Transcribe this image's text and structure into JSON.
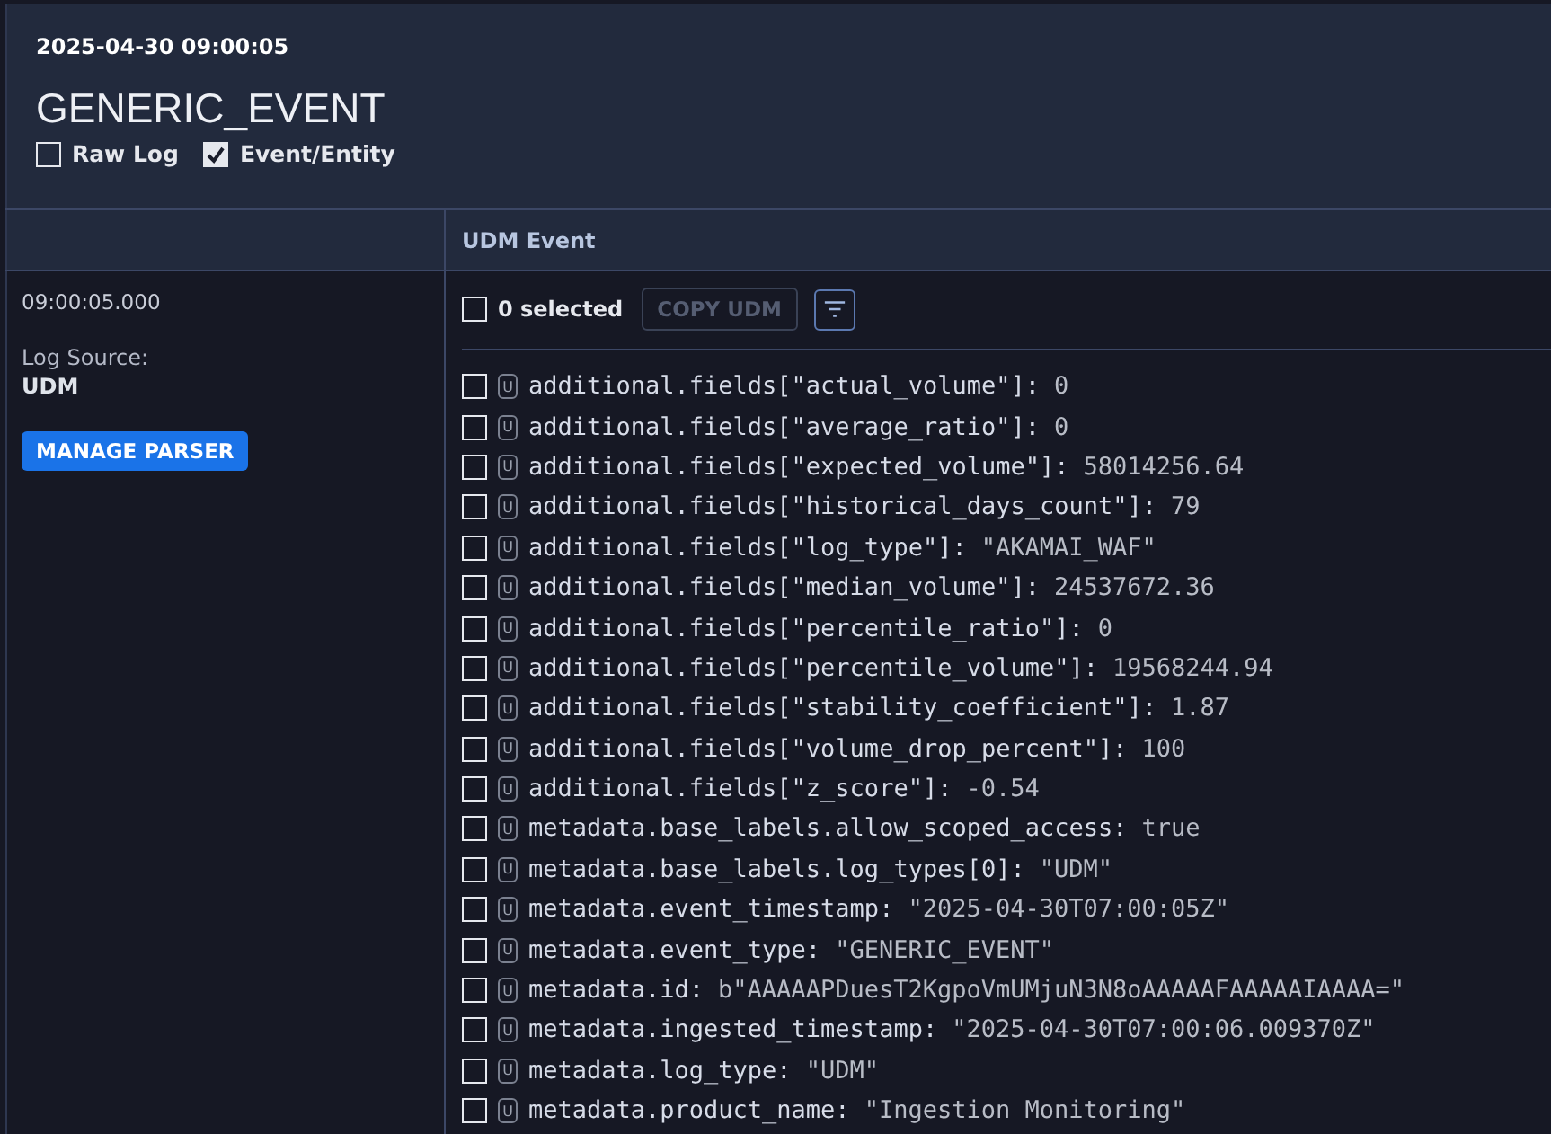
{
  "header": {
    "timestamp": "2025-04-30 09:00:05",
    "title": "GENERIC_EVENT",
    "toggles": [
      {
        "label": "Raw Log",
        "checked": false
      },
      {
        "label": "Event/Entity",
        "checked": true
      }
    ]
  },
  "table": {
    "column_2": "UDM Event"
  },
  "left": {
    "time": "09:00:05.000",
    "source_label": "Log Source:",
    "source_value": "UDM",
    "button": "MANAGE PARSER"
  },
  "toolbar": {
    "selected_count": "0 selected",
    "select_all": false,
    "copy_button": "COPY UDM"
  },
  "fields": [
    {
      "checked": false,
      "badge": "U",
      "key": "additional.fields[\"actual_volume\"]:",
      "value": "0"
    },
    {
      "checked": false,
      "badge": "U",
      "key": "additional.fields[\"average_ratio\"]:",
      "value": "0"
    },
    {
      "checked": false,
      "badge": "U",
      "key": "additional.fields[\"expected_volume\"]:",
      "value": "58014256.64"
    },
    {
      "checked": false,
      "badge": "U",
      "key": "additional.fields[\"historical_days_count\"]:",
      "value": "79"
    },
    {
      "checked": false,
      "badge": "U",
      "key": "additional.fields[\"log_type\"]:",
      "value": "\"AKAMAI_WAF\""
    },
    {
      "checked": false,
      "badge": "U",
      "key": "additional.fields[\"median_volume\"]:",
      "value": "24537672.36"
    },
    {
      "checked": false,
      "badge": "U",
      "key": "additional.fields[\"percentile_ratio\"]:",
      "value": "0"
    },
    {
      "checked": false,
      "badge": "U",
      "key": "additional.fields[\"percentile_volume\"]:",
      "value": "19568244.94"
    },
    {
      "checked": false,
      "badge": "U",
      "key": "additional.fields[\"stability_coefficient\"]:",
      "value": "1.87"
    },
    {
      "checked": false,
      "badge": "U",
      "key": "additional.fields[\"volume_drop_percent\"]:",
      "value": "100"
    },
    {
      "checked": false,
      "badge": "U",
      "key": "additional.fields[\"z_score\"]:",
      "value": "-0.54"
    },
    {
      "checked": false,
      "badge": "U",
      "key": "metadata.base_labels.allow_scoped_access:",
      "value": "true"
    },
    {
      "checked": false,
      "badge": "U",
      "key": "metadata.base_labels.log_types[0]:",
      "value": "\"UDM\""
    },
    {
      "checked": false,
      "badge": "U",
      "key": "metadata.event_timestamp:",
      "value": "\"2025-04-30T07:00:05Z\""
    },
    {
      "checked": false,
      "badge": "U",
      "key": "metadata.event_type:",
      "value": "\"GENERIC_EVENT\""
    },
    {
      "checked": false,
      "badge": "U",
      "key": "metadata.id:",
      "value": "b\"AAAAAPDuesT2KgpoVmUMjuN3N8oAAAAAFAAAAAIAAAA=\""
    },
    {
      "checked": false,
      "badge": "U",
      "key": "metadata.ingested_timestamp:",
      "value": "\"2025-04-30T07:00:06.009370Z\""
    },
    {
      "checked": false,
      "badge": "U",
      "key": "metadata.log_type:",
      "value": "\"UDM\""
    },
    {
      "checked": false,
      "badge": "U",
      "key": "metadata.product_name:",
      "value": "\"Ingestion Monitoring\""
    }
  ]
}
